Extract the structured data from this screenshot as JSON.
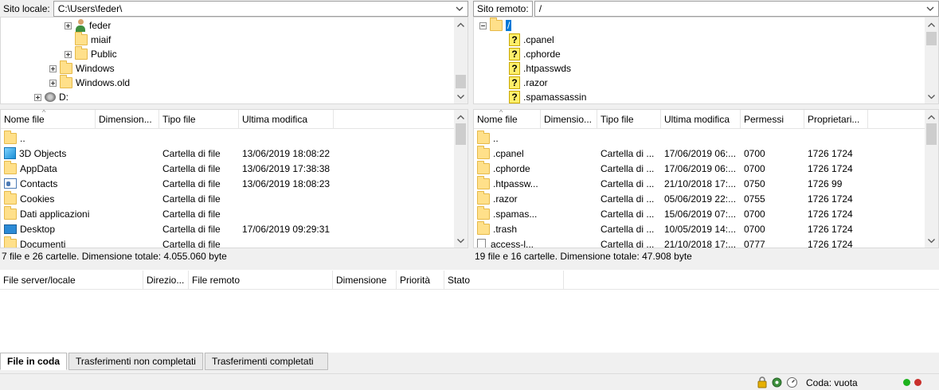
{
  "local": {
    "site_label": "Sito locale:",
    "path": "C:\\Users\\feder\\",
    "tree": [
      {
        "label": "feder",
        "icon": "user-folder-icon",
        "expander": "plus"
      },
      {
        "label": "miaif",
        "icon": "folder-icon",
        "expander": "none"
      },
      {
        "label": "Public",
        "icon": "folder-icon",
        "expander": "plus"
      },
      {
        "label": "Windows",
        "icon": "folder-icon",
        "expander": "plus"
      },
      {
        "label": "Windows.old",
        "icon": "folder-icon",
        "expander": "plus"
      },
      {
        "label": "D:",
        "icon": "drive-icon",
        "expander": "plus"
      }
    ],
    "columns": [
      "Nome file",
      "Dimension...",
      "Tipo file",
      "Ultima modifica"
    ],
    "files": [
      {
        "name": "..",
        "icon": "folder-icon",
        "size": "",
        "type": "",
        "modified": ""
      },
      {
        "name": "3D Objects",
        "icon": "3d-objects-icon",
        "size": "",
        "type": "Cartella di file",
        "modified": "13/06/2019 18:08:22"
      },
      {
        "name": "AppData",
        "icon": "folder-icon",
        "size": "",
        "type": "Cartella di file",
        "modified": "13/06/2019 17:38:38"
      },
      {
        "name": "Contacts",
        "icon": "contacts-icon",
        "size": "",
        "type": "Cartella di file",
        "modified": "13/06/2019 18:08:23"
      },
      {
        "name": "Cookies",
        "icon": "folder-icon",
        "size": "",
        "type": "Cartella di file",
        "modified": ""
      },
      {
        "name": "Dati applicazioni",
        "icon": "folder-icon",
        "size": "",
        "type": "Cartella di file",
        "modified": ""
      },
      {
        "name": "Desktop",
        "icon": "desktop-icon",
        "size": "",
        "type": "Cartella di file",
        "modified": "17/06/2019 09:29:31"
      },
      {
        "name": "Documenti",
        "icon": "folder-icon",
        "size": "",
        "type": "Cartella di file",
        "modified": ""
      }
    ],
    "status": "7 file e 26 cartelle. Dimensione totale: 4.055.060 byte"
  },
  "remote": {
    "site_label": "Sito remoto:",
    "path": "/",
    "tree": [
      {
        "label": "/",
        "icon": "folder-icon",
        "expander": "minus"
      },
      {
        "label": ".cpanel",
        "icon": "unknown-folder-icon",
        "expander": "none"
      },
      {
        "label": ".cphorde",
        "icon": "unknown-folder-icon",
        "expander": "none"
      },
      {
        "label": ".htpasswds",
        "icon": "unknown-folder-icon",
        "expander": "none"
      },
      {
        "label": ".razor",
        "icon": "unknown-folder-icon",
        "expander": "none"
      },
      {
        "label": ".spamassassin",
        "icon": "unknown-folder-icon",
        "expander": "none"
      }
    ],
    "columns": [
      "Nome file",
      "Dimensio...",
      "Tipo file",
      "Ultima modifica",
      "Permessi",
      "Proprietari..."
    ],
    "files": [
      {
        "name": "..",
        "icon": "folder-icon",
        "size": "",
        "type": "",
        "modified": "",
        "perm": "",
        "owner": ""
      },
      {
        "name": ".cpanel",
        "icon": "folder-icon",
        "size": "",
        "type": "Cartella di ...",
        "modified": "17/06/2019 06:...",
        "perm": "0700",
        "owner": "1726 1724"
      },
      {
        "name": ".cphorde",
        "icon": "folder-icon",
        "size": "",
        "type": "Cartella di ...",
        "modified": "17/06/2019 06:...",
        "perm": "0700",
        "owner": "1726 1724"
      },
      {
        "name": ".htpassw...",
        "icon": "folder-icon",
        "size": "",
        "type": "Cartella di ...",
        "modified": "21/10/2018 17:...",
        "perm": "0750",
        "owner": "1726 99"
      },
      {
        "name": ".razor",
        "icon": "folder-icon",
        "size": "",
        "type": "Cartella di ...",
        "modified": "05/06/2019 22:...",
        "perm": "0755",
        "owner": "1726 1724"
      },
      {
        "name": ".spamas...",
        "icon": "folder-icon",
        "size": "",
        "type": "Cartella di ...",
        "modified": "15/06/2019 07:...",
        "perm": "0700",
        "owner": "1726 1724"
      },
      {
        "name": ".trash",
        "icon": "folder-icon",
        "size": "",
        "type": "Cartella di ...",
        "modified": "10/05/2019 14:...",
        "perm": "0700",
        "owner": "1726 1724"
      },
      {
        "name": "access-l...",
        "icon": "file-icon",
        "size": "",
        "type": "Cartella di ...",
        "modified": "21/10/2018 17:...",
        "perm": "0777",
        "owner": "1726 1724"
      }
    ],
    "status": "19 file e 16 cartelle. Dimensione totale: 47.908 byte"
  },
  "queue": {
    "columns": [
      "File server/locale",
      "Direzio...",
      "File remoto",
      "Dimensione",
      "Priorità",
      "Stato"
    ],
    "tabs": [
      "File in coda",
      "Trasferimenti non completati",
      "Trasferimenti completati"
    ],
    "active_tab": 0,
    "status": "Coda: vuota"
  },
  "colors": {
    "selection": "#0078d7",
    "folder": "#ffe08a",
    "led_green": "#1db31d",
    "led_red": "#c9302c"
  }
}
